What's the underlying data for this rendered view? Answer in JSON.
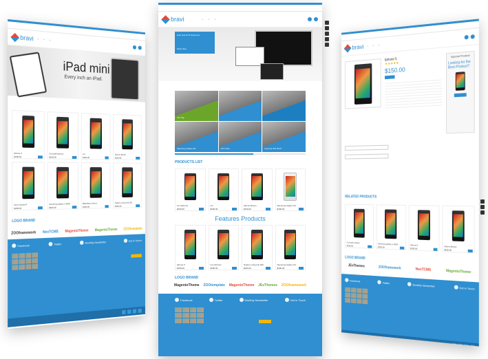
{
  "colors": {
    "accent": "#2f8fd0",
    "footer": "#2f8fd0",
    "footer_dark": "#1f6fa8",
    "button_yellow": "#f2b705"
  },
  "brand": {
    "logo_text": "bravi"
  },
  "left": {
    "hero_title": "iPad mini",
    "hero_subtitle": "Every inch an iPad.",
    "products": [
      {
        "name": "Iphone 4",
        "price": "$150.00",
        "light": false
      },
      {
        "name": "Comodel Iphone",
        "price": "$150.00",
        "light": false
      },
      {
        "name": "LG",
        "price": "$150.00",
        "light": false
      },
      {
        "name": "Iphone Brown",
        "price": "$150.00",
        "light": false
      },
      {
        "name": "Sony Xperia P",
        "price": "$150.00",
        "light": false
      },
      {
        "name": "Samsung galaxy s-3000",
        "price": "$150.00",
        "light": false
      },
      {
        "name": "Blackberry Storm",
        "price": "$150.00",
        "light": false
      },
      {
        "name": "Nokia Lumia pink 920",
        "price": "$150.00",
        "light": false
      }
    ],
    "logo_brand": "LOGO BRAND",
    "brands": [
      "ZOOframework",
      "NeoTCMS",
      "MagentoTheme",
      "MagentoTheme",
      "ZOOtemplate"
    ],
    "footer": {
      "facebook": "Facebook",
      "twitter": "Twitter",
      "newsletter": "Monthly Newsletter",
      "touch": "Get in Touch"
    }
  },
  "center": {
    "promo_title": "How cool is it? Great you",
    "promo_btn": "Shop Now",
    "tiles": [
      {
        "label": "Life Tag"
      },
      {
        "label": ""
      },
      {
        "label": ""
      },
      {
        "label": "Samsung Galaxy S5"
      },
      {
        "label": "HTC New"
      },
      {
        "label": "Keynote iOS 2013"
      }
    ],
    "products_list_title": "PRODUCTS LIST",
    "products_list": [
      {
        "name": "LG Optimus",
        "price": "$150.00",
        "light": false
      },
      {
        "name": "LG",
        "price": "$150.00",
        "light": false
      },
      {
        "name": "Iphone Brown",
        "price": "$150.00",
        "light": false
      },
      {
        "name": "Samsung Galaxy S3",
        "price": "$150.00",
        "light": true
      }
    ],
    "features_title": "Features Products",
    "features": [
      {
        "name": "Iphone 5",
        "price": "$150.00",
        "light": false
      },
      {
        "name": "LG Optimus",
        "price": "$150.00",
        "light": false
      },
      {
        "name": "Nokia Lumia pink 920",
        "price": "$150.00",
        "light": false
      },
      {
        "name": "Samsung Galaxy S3",
        "price": "$150.00",
        "light": false
      }
    ],
    "logo_brand": "LOGO BRAND",
    "brands": [
      "MagentoTheme",
      "ZOOtemplate",
      "MagentoTheme",
      "JEvThemes",
      "ZOOframework"
    ],
    "footer": {
      "facebook": "Facebook",
      "twitter": "Twitter",
      "newsletter": "Monthly Newsletter",
      "touch": "Get in Touch"
    }
  },
  "right": {
    "product_name": "Iphone 5",
    "price": "$150.00",
    "special_title": "Special Product",
    "special_text": "Looking for the Best Product?",
    "related_title": "RELATED PRODUCTS",
    "related": [
      {
        "name": "Comodel Iphone",
        "price": "$150.00",
        "light": false
      },
      {
        "name": "Samsung galaxy s-3000",
        "price": "$150.00",
        "light": false
      },
      {
        "name": "Iphone 5",
        "price": "$150.00",
        "light": false
      },
      {
        "name": "Iphone Brown",
        "price": "$150.00",
        "light": false
      }
    ],
    "logo_brand": "LOGO BRAND",
    "brands": [
      "JEvThemes",
      "ZOOframework",
      "NeoTCMS",
      "MagentoTheme"
    ],
    "footer": {
      "facebook": "Facebook",
      "twitter": "Twitter",
      "newsletter": "Monthly Newsletter",
      "touch": "Get in Touch"
    }
  }
}
